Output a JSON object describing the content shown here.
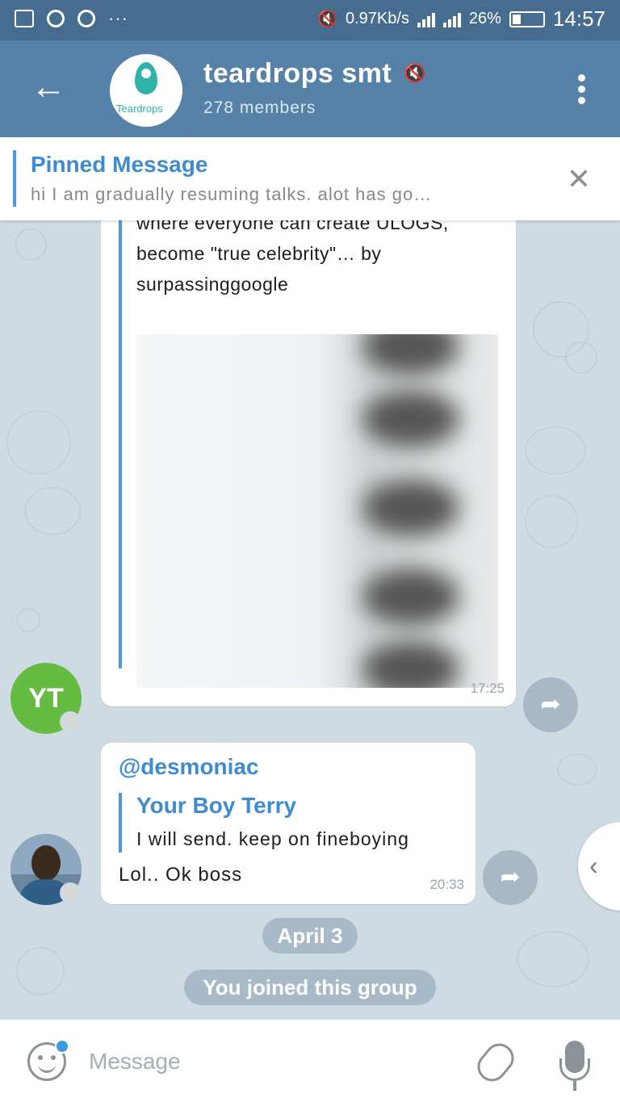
{
  "status_bar": {
    "network_speed": "0.97Kb/s",
    "battery": "26%",
    "time": "14:57"
  },
  "header": {
    "back_icon": "arrow-left-icon",
    "group_name": "teardrops smt",
    "avatar_text": "Teardrops",
    "members": "278 members",
    "muted_icon": "speaker-muted-icon",
    "menu_icon": "kebab-menu-icon"
  },
  "pinned": {
    "title": "Pinned Message",
    "text": "hi I am gradually resuming talks. alot has go…"
  },
  "messages": [
    {
      "sender_initials": "YT",
      "sender_color": "#66bb42",
      "text": "where everyone can create ULOGS, become \"true celebrity\"… by surpassinggoogle",
      "time": "17:25"
    },
    {
      "mention": "@desmoniac",
      "reply_author": "Your Boy Terry",
      "reply_text": "I will send. keep on fineboying",
      "text": "Lol.. Ok boss",
      "time": "20:33"
    }
  ],
  "service": {
    "date": "April 3",
    "joined": "You joined this group"
  },
  "input": {
    "placeholder": "Message"
  },
  "colors": {
    "header_bg": "#5682a9",
    "accent": "#3e8bd0",
    "chat_bg": "#cfdbe3"
  }
}
